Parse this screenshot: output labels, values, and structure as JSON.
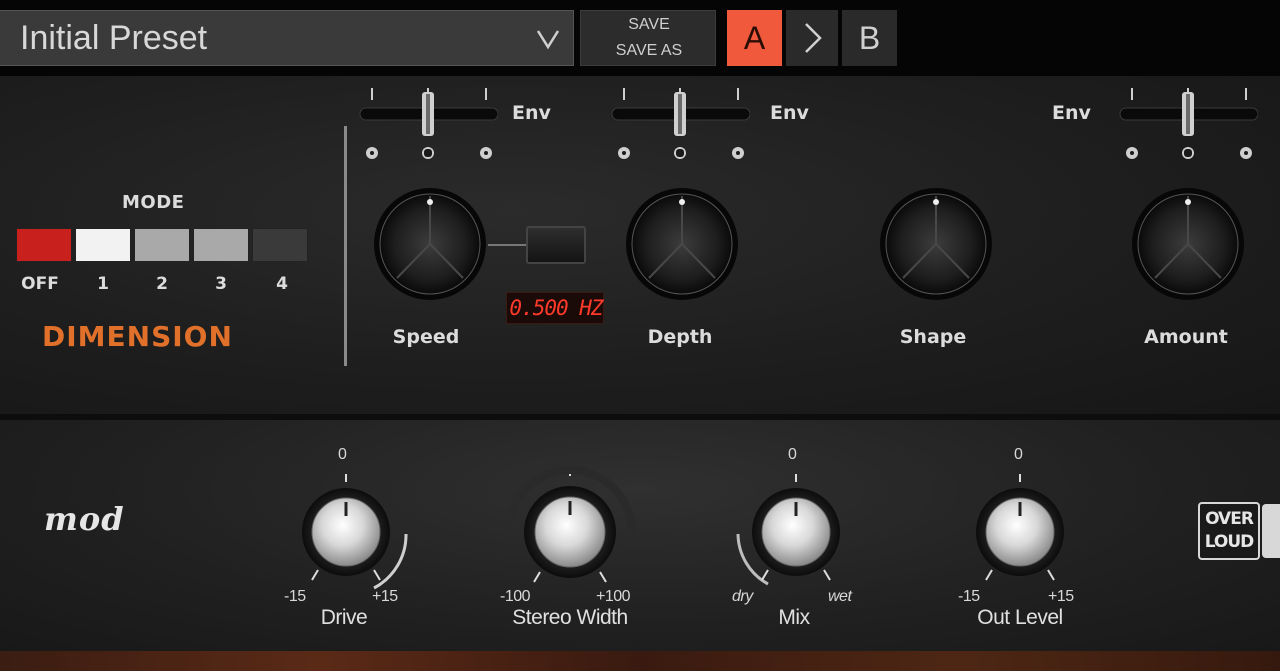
{
  "topbar": {
    "preset_name": "Initial Preset",
    "preset_dropdown_icon": "chevron-down-icon",
    "save_label": "SAVE",
    "save_as_label": "SAVE AS",
    "slot_a": "A",
    "copy_icon": "chevron-right-icon",
    "slot_b": "B",
    "active_slot_color": "#f0593c"
  },
  "dimension": {
    "title": "DIMENSION",
    "title_color": "#e0702a",
    "mode": {
      "title": "MODE",
      "options": [
        "OFF",
        "1",
        "2",
        "3",
        "4"
      ],
      "selected": "OFF"
    },
    "env_label": "Env",
    "speed_display": "0.500 HZ",
    "knobs": {
      "speed": "Speed",
      "depth": "Depth",
      "shape": "Shape",
      "amount": "Amount"
    }
  },
  "mod": {
    "logo": "mod",
    "knobs": {
      "drive": {
        "label": "Drive",
        "top": "0",
        "min": "-15",
        "max": "+15"
      },
      "stereo_width": {
        "label": "Stereo Width",
        "min": "-100",
        "max": "+100"
      },
      "mix": {
        "label": "Mix",
        "top": "0",
        "min": "dry",
        "max": "wet"
      },
      "out_level": {
        "label": "Out Level",
        "top": "0",
        "min": "-15",
        "max": "+15"
      }
    },
    "brand_line1": "OVER",
    "brand_line2": "LOUD"
  }
}
